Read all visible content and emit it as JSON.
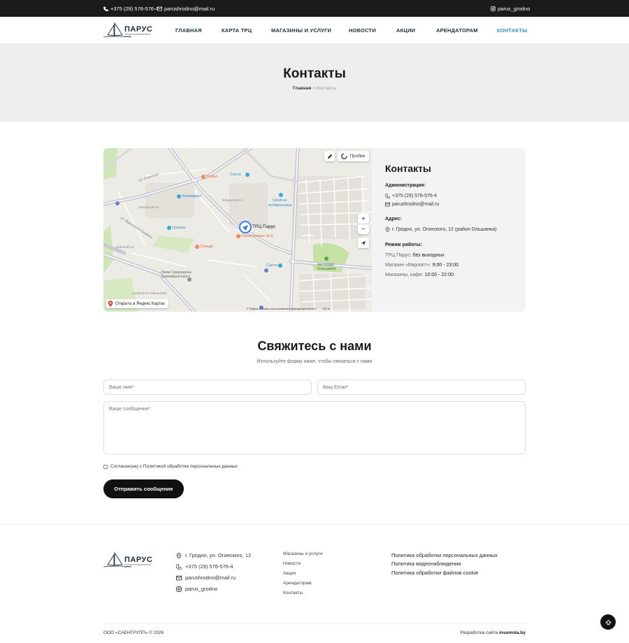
{
  "topbar": {
    "phone": "+375 (29) 576-576-4",
    "email": "parushrodno@mail.ru",
    "instagram": "parus_grodno"
  },
  "logo": {
    "brand": "ПАРУС",
    "tagline": "ТОРГОВО-РАЗВЛЕКАТЕЛЬНЫЙ ЦЕНТР"
  },
  "nav": [
    {
      "label": "ГЛАВНАЯ",
      "active": false
    },
    {
      "label": "КАРТА ТРЦ",
      "active": false
    },
    {
      "label": "МАГАЗИНЫ И УСЛУГИ",
      "active": false
    },
    {
      "label": "НОВОСТИ",
      "active": false
    },
    {
      "label": "АКЦИИ",
      "active": false
    },
    {
      "label": "АРЕНДАТОРАМ",
      "active": false
    },
    {
      "label": "КОНТАКТЫ",
      "active": true
    }
  ],
  "hero": {
    "title": "Контакты",
    "breadcrumb_home": "Главная",
    "breadcrumb_sep": ">",
    "breadcrumb_current": "Контакты"
  },
  "map": {
    "traffic_label": "Пробки",
    "open_label": "Открыть в Яндекс Картах",
    "copyright": "© Яндекс   Условия использования   Конфиденциальность",
    "scale": "200 м",
    "zoom_in": "+",
    "zoom_out": "−",
    "places": {
      "mall": "ТРЦ Парус",
      "royal": "Ройал",
      "santa1": "Санта",
      "santa2": "Санта",
      "belmarket": "Белмаркет",
      "unistore": "Unistore",
      "unistore2": "опт&розница",
      "grosh": "Грошык",
      "clinic": "Поликлиника № 8",
      "sosed": "Соседи",
      "park": "лесопарк",
      "park2": "Ольшанка",
      "church": "Храм Свиридона",
      "church2": "Тримифунтского",
      "street_ogin": "ул. Огинского",
      "street_frant": "ул. Франтишка Скорины",
      "district": "ОЛЬШАНКА-2",
      "district2": "ОЛЬШАНКА-5",
      "district3": "ЮЖНЫЙ-14",
      "district4": "БОЛЬШАЯ ОЛЬШАНКА"
    }
  },
  "contacts_card": {
    "title": "Контакты",
    "admin_label": "Администрация:",
    "phone": "+375 (29) 576-576-4",
    "email": "parushrodno@mail.ru",
    "address_label": "Адрес:",
    "address": "г. Гродно, ул. Огинского, 12 (район Ольшанка)",
    "hours_label": "Режим работы:",
    "hours": [
      {
        "name": "ТРЦ Парус:",
        "value": "без выходных"
      },
      {
        "name": "Магазин «Евроопт»:",
        "value": "9:00 - 23:00"
      },
      {
        "name": "Магазины, кафе:",
        "value": "10:00 - 22:00"
      }
    ]
  },
  "form": {
    "title": "Свяжитесь с нами",
    "subtitle": "Используйте форму ниже, чтобы связаться с нами",
    "name_placeholder": "Ваше имя*",
    "email_placeholder": "Ваш Email*",
    "message_placeholder": "Ваше сообщение*",
    "consent": "Согласен(на) с Политикой обработки персональных данных",
    "submit": "Отправить сообщение"
  },
  "footer": {
    "address": "г. Гродно, ул. Огинского, 12",
    "phone": "+375 (29) 576-576-4",
    "email": "parushrodno@mail.ru",
    "instagram": "parus_grodno",
    "links": [
      "Магазины и услуги",
      "Новости",
      "Акции",
      "Арендаторам",
      "Контакты"
    ],
    "policies": [
      "Политика обработки персональных данных",
      "Политика видеонаблюдения",
      "Политика обработки файлов cookie"
    ],
    "copyright": "ООО «САЕНГРУПП» © 2026",
    "dev_prefix": "Разработка сайта",
    "dev_name": "insomnia.by"
  },
  "colors": {
    "accent": "#3a8ecb",
    "dark": "#111111",
    "hero_bg": "#eeeeee",
    "card_bg": "#f3f3f3"
  }
}
